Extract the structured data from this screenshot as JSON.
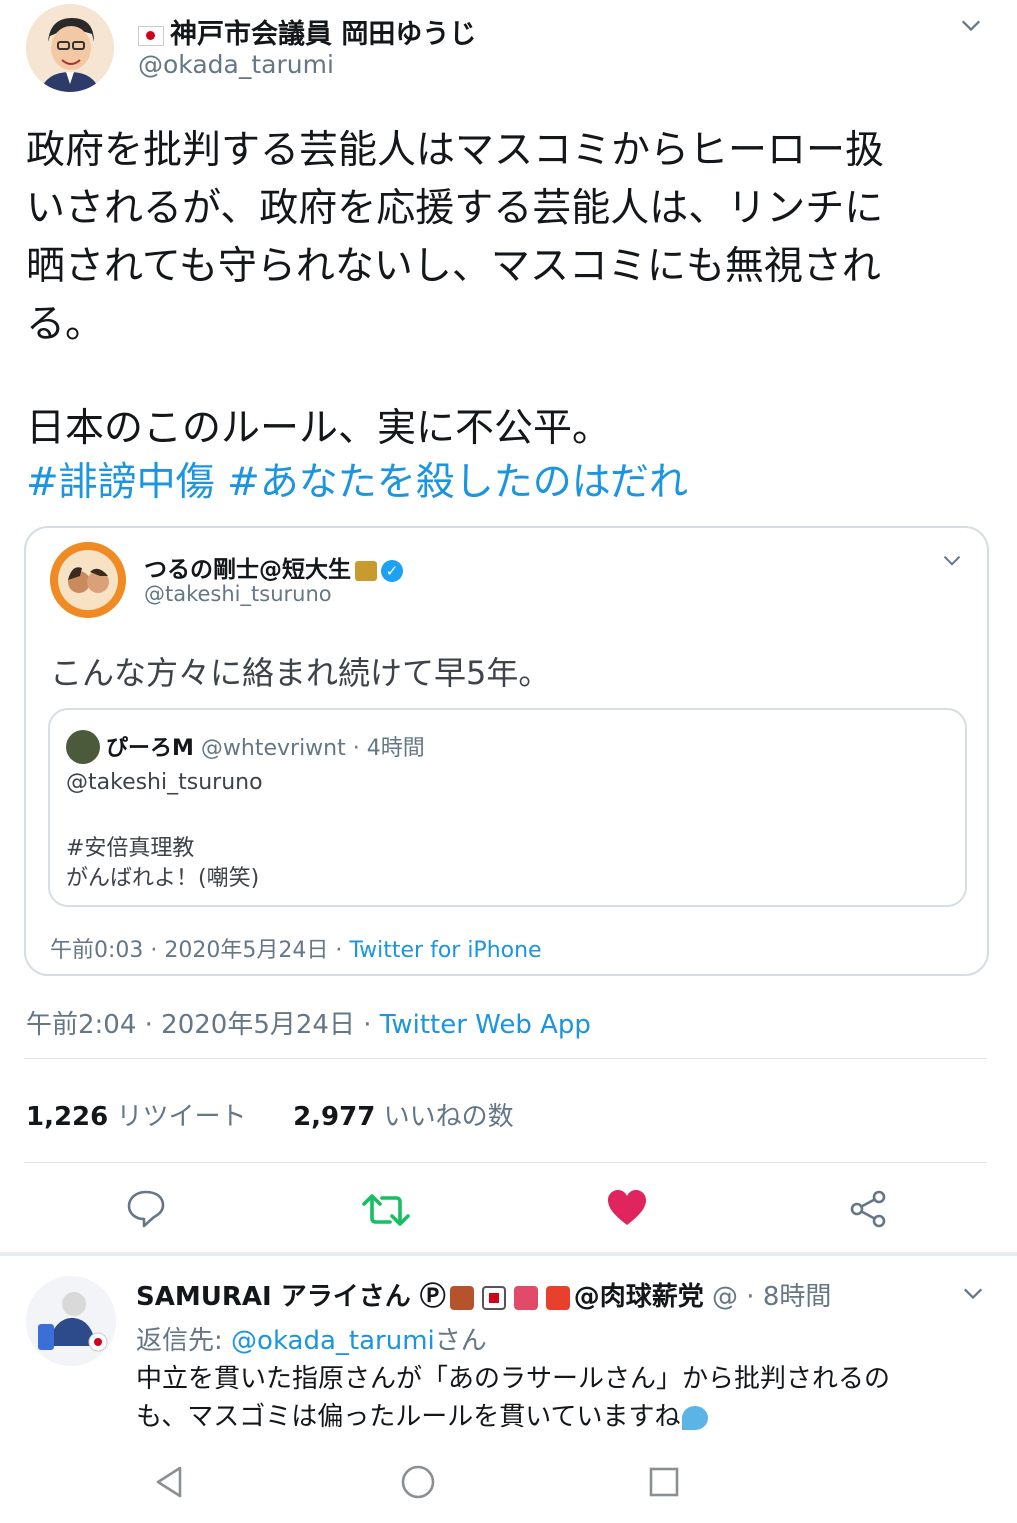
{
  "main_tweet": {
    "display_name": "神戸市会議員 岡田ゆうじ",
    "handle": "@okada_tarumi",
    "body_lines": [
      "政府を批判する芸能人はマスコミからヒーロー扱",
      "いされるが、政府を応援する芸能人は、リンチに",
      "晒されても守られないし、マスコミにも無視され",
      "る。"
    ],
    "body_line2": "日本のこのルール、実に不公平。",
    "hashtags": [
      "#誹謗中傷",
      "#あなたを殺したのはだれ"
    ],
    "timestamp": "午前2:04 · 2020年5月24日 · ",
    "source": "Twitter Web App",
    "retweets_count": "1,226",
    "retweets_label": "リツイート",
    "likes_count": "2,977",
    "likes_label": "いいねの数"
  },
  "quoted_tweet": {
    "display_name": "つるの剛士@短大生",
    "handle": "@takeshi_tsuruno",
    "body": "こんな方々に絡まれ続けて早5年。",
    "timestamp": "午前0:03 · 2020年5月24日 · ",
    "source": "Twitter for iPhone",
    "nested": {
      "display_name": "ぴーろM",
      "handle_time": "@whtevriwnt · 4時間",
      "mention": "@takeshi_tsuruno",
      "hashtag": "#安倍真理教",
      "text": "がんばれよ！(嘲笑)"
    }
  },
  "reply": {
    "display_name": "SAMURAI アライさん Ⓟ",
    "display_suffix": "@肉球薪党",
    "handle_time": "@ · 8時間",
    "reply_to_label": "返信先: ",
    "reply_to_handle": "@okada_tarumi",
    "reply_to_suffix": "さん",
    "body_lines": [
      "中立を貫いた指原さんが「あのラサールさん」から批判されるの",
      "も、マスゴミは偏ったルールを貫いていますね"
    ]
  },
  "colors": {
    "link": "#1b95e0",
    "retweet": "#17bf63",
    "like": "#e0245e",
    "muted": "#657786"
  },
  "icons": [
    "chevron-down-icon",
    "reply-icon",
    "retweet-icon",
    "heart-icon",
    "share-icon",
    "back-icon",
    "home-icon",
    "recent-apps-icon"
  ]
}
